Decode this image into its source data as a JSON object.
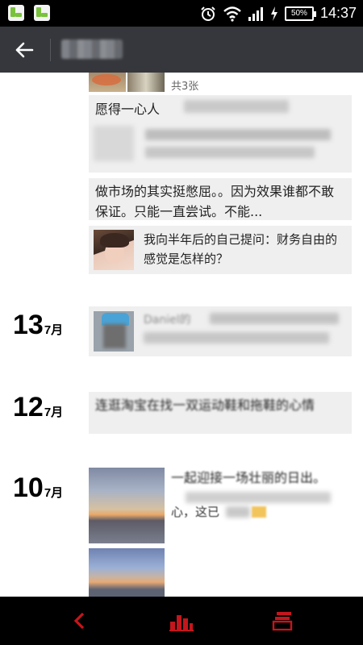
{
  "status_bar": {
    "time": "14:37",
    "battery": "50%"
  },
  "app_bar": {
    "back_icon": "arrow-left-icon"
  },
  "feed": {
    "photo_count": "共3张",
    "blurred_post_heading": "愿得一心人",
    "post_market": "做市场的其实挺憋屈。。因为效果谁都不敢保证。只能一直尝试。不能...",
    "shared_question": "我向半年后的自己提问：财务自由的感觉是怎样的？",
    "days": [
      {
        "day": "13",
        "month": "7月"
      },
      {
        "day": "12",
        "month": "7月"
      },
      {
        "day": "10",
        "month": "7月"
      }
    ],
    "share_blurred_name": "Daniel的",
    "post_12": "连逛淘宝在找一双运动鞋和拖鞋的心情",
    "post_10": "一起迎接一场壮丽的日出。",
    "post_10_tail": "心，这已"
  },
  "bottom_bar": {
    "back": "chevron-left-icon",
    "chart": "bar-chart-icon",
    "list": "stack-icon"
  }
}
